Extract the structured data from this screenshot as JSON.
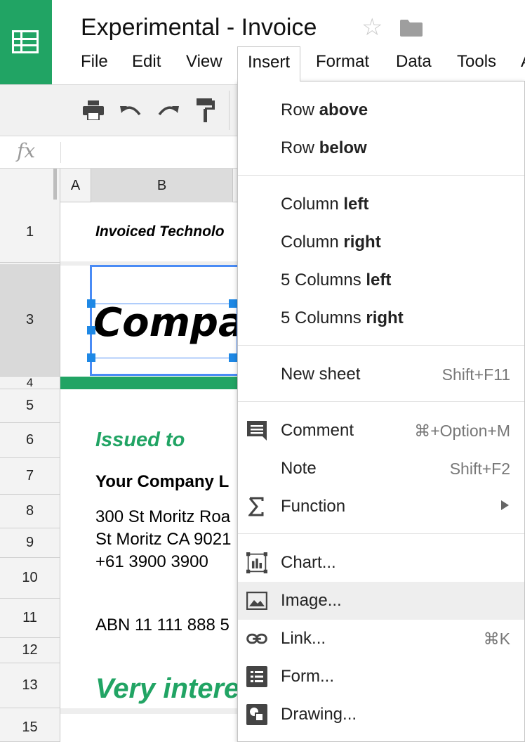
{
  "app": {
    "title": "Experimental - Invoice",
    "icon": "google-sheets-icon",
    "accent": "#21a464"
  },
  "menubar": {
    "items": [
      "File",
      "Edit",
      "View",
      "Insert",
      "Format",
      "Data",
      "Tools",
      "A"
    ],
    "active": "Insert"
  },
  "toolbar": {
    "buttons": [
      "print-icon",
      "undo-icon",
      "redo-icon",
      "paint-format-icon"
    ]
  },
  "formula_bar": {
    "label": "fx",
    "value": ""
  },
  "grid": {
    "columns": [
      "A",
      "B"
    ],
    "rows": [
      "1",
      "3",
      "4",
      "5",
      "6",
      "7",
      "8",
      "9",
      "10",
      "11",
      "12",
      "13",
      "15"
    ],
    "cells": {
      "r1": "Invoiced Technolo",
      "r3_image_text": "Compar",
      "r6": "Issued to",
      "r7": "Your Company L",
      "r8": "300 St Moritz Roa",
      "r9": "St Moritz CA 9021",
      "r9b": "+61 3900 3900",
      "r11": "ABN 11 111 888 5",
      "r13": "Very intere"
    },
    "selection_color": "#4a8bf5"
  },
  "insert_menu": {
    "row_group": [
      {
        "prefix": "Row ",
        "bold": "above",
        "shortcut": ""
      },
      {
        "prefix": "Row ",
        "bold": "below",
        "shortcut": ""
      }
    ],
    "column_group": [
      {
        "prefix": "Column ",
        "bold": "left",
        "shortcut": ""
      },
      {
        "prefix": "Column ",
        "bold": "right",
        "shortcut": ""
      },
      {
        "prefix": "5 Columns ",
        "bold": "left",
        "shortcut": ""
      },
      {
        "prefix": "5 Columns ",
        "bold": "right",
        "shortcut": ""
      }
    ],
    "new_sheet": {
      "label": "New sheet",
      "shortcut": "Shift+F11"
    },
    "comment": {
      "label": "Comment",
      "shortcut": "⌘+Option+M",
      "icon": "comment-icon"
    },
    "note": {
      "label": "Note",
      "shortcut": "Shift+F2"
    },
    "function": {
      "label": "Function",
      "icon": "sigma-icon",
      "submenu_icon": "chevron-right-icon"
    },
    "chart": {
      "label": "Chart...",
      "icon": "chart-icon"
    },
    "image": {
      "label": "Image...",
      "icon": "image-icon",
      "highlighted": true
    },
    "link": {
      "label": "Link...",
      "shortcut": "⌘K",
      "icon": "link-icon"
    },
    "form": {
      "label": "Form...",
      "icon": "form-icon"
    },
    "drawing": {
      "label": "Drawing...",
      "icon": "drawing-icon"
    }
  }
}
